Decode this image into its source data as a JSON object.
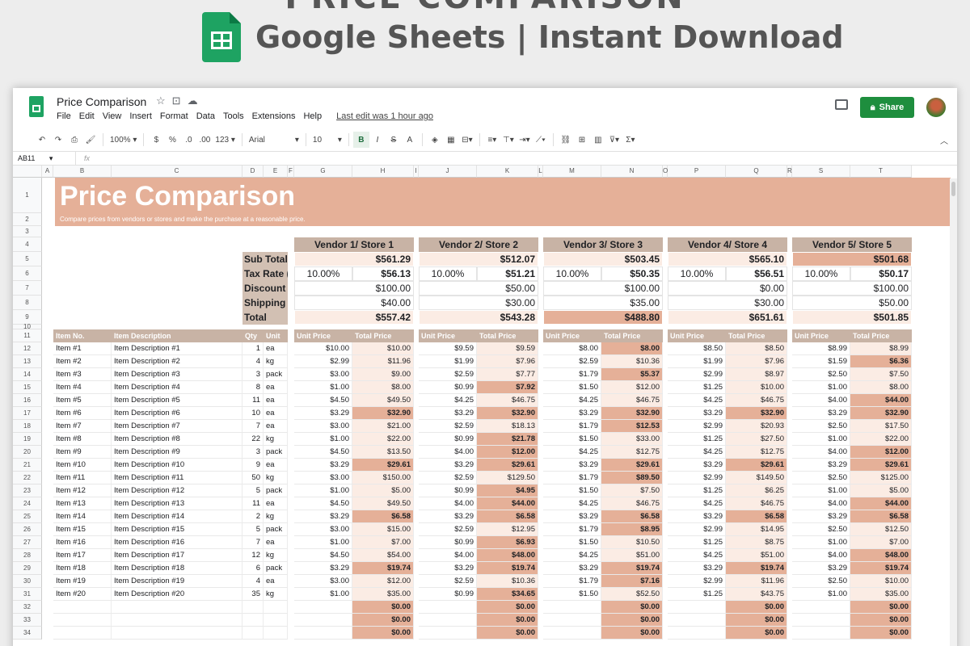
{
  "banner": {
    "cut_text": "PRICE COMPARISON",
    "subtitle": "Google Sheets | Instant Download"
  },
  "app": {
    "title": "Price Comparison",
    "menu": [
      "File",
      "Edit",
      "View",
      "Insert",
      "Format",
      "Data",
      "Tools",
      "Extensions",
      "Help"
    ],
    "last_edit": "Last edit was 1 hour ago",
    "share_label": "Share"
  },
  "toolbar": {
    "zoom": "100%",
    "currency": "$",
    "percent": "%",
    "dec_less": ".0",
    "dec_more": ".00",
    "number_format": "123",
    "font": "Arial",
    "font_size": "10",
    "bold": "B",
    "italic": "I",
    "strike": "S",
    "text_color": "A"
  },
  "formula": {
    "name_box": "AB11",
    "fx": "fx"
  },
  "columns": [
    "A",
    "B",
    "C",
    "D",
    "E",
    "F",
    "G",
    "H",
    "I",
    "J",
    "K",
    "L",
    "M",
    "N",
    "O",
    "P",
    "Q",
    "R",
    "S",
    "T"
  ],
  "rows": [
    "1",
    "2",
    "3",
    "4",
    "5",
    "6",
    "7",
    "8",
    "9",
    "10",
    "11",
    "12",
    "13",
    "14",
    "15",
    "16",
    "17",
    "18",
    "19",
    "20",
    "21",
    "22",
    "23",
    "24",
    "25",
    "26",
    "27",
    "28",
    "29",
    "30",
    "31",
    "32",
    "33",
    "34"
  ],
  "sheet": {
    "title": "Price Comparison",
    "subtitle": "Compare prices from vendors or stores and make the purchase at a reasonable price.",
    "summary_labels": [
      "Sub Total",
      "Tax Rate (%)",
      "Discount",
      "Shipping",
      "Total"
    ],
    "vendors": [
      {
        "name": "Vendor 1/ Store 1",
        "subtotal": "$561.29",
        "rate": "10.00%",
        "tax": "$56.13",
        "discount": "$100.00",
        "shipping": "$40.00",
        "total": "$557.42"
      },
      {
        "name": "Vendor 2/ Store 2",
        "subtotal": "$512.07",
        "rate": "10.00%",
        "tax": "$51.21",
        "discount": "$50.00",
        "shipping": "$30.00",
        "total": "$543.28"
      },
      {
        "name": "Vendor 3/ Store 3",
        "subtotal": "$503.45",
        "rate": "10.00%",
        "tax": "$50.35",
        "discount": "$100.00",
        "shipping": "$35.00",
        "total": "$488.80"
      },
      {
        "name": "Vendor 4/ Store 4",
        "subtotal": "$565.10",
        "rate": "10.00%",
        "tax": "$56.51",
        "discount": "$0.00",
        "shipping": "$30.00",
        "total": "$651.61"
      },
      {
        "name": "Vendor 5/ Store 5",
        "subtotal": "$501.68",
        "rate": "10.00%",
        "tax": "$50.17",
        "discount": "$100.00",
        "shipping": "$50.00",
        "total": "$501.85"
      }
    ],
    "item_headers": [
      "Item No.",
      "Item Description",
      "Qty",
      "Unit"
    ],
    "price_headers": [
      "Unit Price",
      "Total Price"
    ],
    "items": [
      [
        "Item #1",
        "Item Description #1",
        "1",
        "ea"
      ],
      [
        "Item #2",
        "Item Description #2",
        "4",
        "kg"
      ],
      [
        "Item #3",
        "Item Description #3",
        "3",
        "pack"
      ],
      [
        "Item #4",
        "Item Description #4",
        "8",
        "ea"
      ],
      [
        "Item #5",
        "Item Description #5",
        "11",
        "ea"
      ],
      [
        "Item #6",
        "Item Description #6",
        "10",
        "ea"
      ],
      [
        "Item #7",
        "Item Description #7",
        "7",
        "ea"
      ],
      [
        "Item #8",
        "Item Description #8",
        "22",
        "kg"
      ],
      [
        "Item #9",
        "Item Description #9",
        "3",
        "pack"
      ],
      [
        "Item #10",
        "Item Description #10",
        "9",
        "ea"
      ],
      [
        "Item #11",
        "Item Description #11",
        "50",
        "kg"
      ],
      [
        "Item #12",
        "Item Description #12",
        "5",
        "pack"
      ],
      [
        "Item #13",
        "Item Description #13",
        "11",
        "ea"
      ],
      [
        "Item #14",
        "Item Description #14",
        "2",
        "kg"
      ],
      [
        "Item #15",
        "Item Description #15",
        "5",
        "pack"
      ],
      [
        "Item #16",
        "Item Description #16",
        "7",
        "ea"
      ],
      [
        "Item #17",
        "Item Description #17",
        "12",
        "kg"
      ],
      [
        "Item #18",
        "Item Description #18",
        "6",
        "pack"
      ],
      [
        "Item #19",
        "Item Description #19",
        "4",
        "ea"
      ],
      [
        "Item #20",
        "Item Description #20",
        "35",
        "kg"
      ]
    ],
    "prices": [
      [
        [
          "$10.00",
          "$10.00"
        ],
        [
          "$9.59",
          "$9.59"
        ],
        [
          "$8.00",
          "$8.00"
        ],
        [
          "$8.50",
          "$8.50"
        ],
        [
          "$8.99",
          "$8.99"
        ]
      ],
      [
        [
          "$2.99",
          "$11.96"
        ],
        [
          "$1.99",
          "$7.96"
        ],
        [
          "$2.59",
          "$10.36"
        ],
        [
          "$1.99",
          "$7.96"
        ],
        [
          "$1.59",
          "$6.36"
        ]
      ],
      [
        [
          "$3.00",
          "$9.00"
        ],
        [
          "$2.59",
          "$7.77"
        ],
        [
          "$1.79",
          "$5.37"
        ],
        [
          "$2.99",
          "$8.97"
        ],
        [
          "$2.50",
          "$7.50"
        ]
      ],
      [
        [
          "$1.00",
          "$8.00"
        ],
        [
          "$0.99",
          "$7.92"
        ],
        [
          "$1.50",
          "$12.00"
        ],
        [
          "$1.25",
          "$10.00"
        ],
        [
          "$1.00",
          "$8.00"
        ]
      ],
      [
        [
          "$4.50",
          "$49.50"
        ],
        [
          "$4.25",
          "$46.75"
        ],
        [
          "$4.25",
          "$46.75"
        ],
        [
          "$4.25",
          "$46.75"
        ],
        [
          "$4.00",
          "$44.00"
        ]
      ],
      [
        [
          "$3.29",
          "$32.90"
        ],
        [
          "$3.29",
          "$32.90"
        ],
        [
          "$3.29",
          "$32.90"
        ],
        [
          "$3.29",
          "$32.90"
        ],
        [
          "$3.29",
          "$32.90"
        ]
      ],
      [
        [
          "$3.00",
          "$21.00"
        ],
        [
          "$2.59",
          "$18.13"
        ],
        [
          "$1.79",
          "$12.53"
        ],
        [
          "$2.99",
          "$20.93"
        ],
        [
          "$2.50",
          "$17.50"
        ]
      ],
      [
        [
          "$1.00",
          "$22.00"
        ],
        [
          "$0.99",
          "$21.78"
        ],
        [
          "$1.50",
          "$33.00"
        ],
        [
          "$1.25",
          "$27.50"
        ],
        [
          "$1.00",
          "$22.00"
        ]
      ],
      [
        [
          "$4.50",
          "$13.50"
        ],
        [
          "$4.00",
          "$12.00"
        ],
        [
          "$4.25",
          "$12.75"
        ],
        [
          "$4.25",
          "$12.75"
        ],
        [
          "$4.00",
          "$12.00"
        ]
      ],
      [
        [
          "$3.29",
          "$29.61"
        ],
        [
          "$3.29",
          "$29.61"
        ],
        [
          "$3.29",
          "$29.61"
        ],
        [
          "$3.29",
          "$29.61"
        ],
        [
          "$3.29",
          "$29.61"
        ]
      ],
      [
        [
          "$3.00",
          "$150.00"
        ],
        [
          "$2.59",
          "$129.50"
        ],
        [
          "$1.79",
          "$89.50"
        ],
        [
          "$2.99",
          "$149.50"
        ],
        [
          "$2.50",
          "$125.00"
        ]
      ],
      [
        [
          "$1.00",
          "$5.00"
        ],
        [
          "$0.99",
          "$4.95"
        ],
        [
          "$1.50",
          "$7.50"
        ],
        [
          "$1.25",
          "$6.25"
        ],
        [
          "$1.00",
          "$5.00"
        ]
      ],
      [
        [
          "$4.50",
          "$49.50"
        ],
        [
          "$4.00",
          "$44.00"
        ],
        [
          "$4.25",
          "$46.75"
        ],
        [
          "$4.25",
          "$46.75"
        ],
        [
          "$4.00",
          "$44.00"
        ]
      ],
      [
        [
          "$3.29",
          "$6.58"
        ],
        [
          "$3.29",
          "$6.58"
        ],
        [
          "$3.29",
          "$6.58"
        ],
        [
          "$3.29",
          "$6.58"
        ],
        [
          "$3.29",
          "$6.58"
        ]
      ],
      [
        [
          "$3.00",
          "$15.00"
        ],
        [
          "$2.59",
          "$12.95"
        ],
        [
          "$1.79",
          "$8.95"
        ],
        [
          "$2.99",
          "$14.95"
        ],
        [
          "$2.50",
          "$12.50"
        ]
      ],
      [
        [
          "$1.00",
          "$7.00"
        ],
        [
          "$0.99",
          "$6.93"
        ],
        [
          "$1.50",
          "$10.50"
        ],
        [
          "$1.25",
          "$8.75"
        ],
        [
          "$1.00",
          "$7.00"
        ]
      ],
      [
        [
          "$4.50",
          "$54.00"
        ],
        [
          "$4.00",
          "$48.00"
        ],
        [
          "$4.25",
          "$51.00"
        ],
        [
          "$4.25",
          "$51.00"
        ],
        [
          "$4.00",
          "$48.00"
        ]
      ],
      [
        [
          "$3.29",
          "$19.74"
        ],
        [
          "$3.29",
          "$19.74"
        ],
        [
          "$3.29",
          "$19.74"
        ],
        [
          "$3.29",
          "$19.74"
        ],
        [
          "$3.29",
          "$19.74"
        ]
      ],
      [
        [
          "$3.00",
          "$12.00"
        ],
        [
          "$2.59",
          "$10.36"
        ],
        [
          "$1.79",
          "$7.16"
        ],
        [
          "$2.99",
          "$11.96"
        ],
        [
          "$2.50",
          "$10.00"
        ]
      ],
      [
        [
          "$1.00",
          "$35.00"
        ],
        [
          "$0.99",
          "$34.65"
        ],
        [
          "$1.50",
          "$52.50"
        ],
        [
          "$1.25",
          "$43.75"
        ],
        [
          "$1.00",
          "$35.00"
        ]
      ]
    ],
    "min_flags": [
      [
        0,
        0,
        1,
        0,
        0
      ],
      [
        0,
        0,
        0,
        0,
        1
      ],
      [
        0,
        0,
        1,
        0,
        0
      ],
      [
        0,
        1,
        0,
        0,
        0
      ],
      [
        0,
        0,
        0,
        0,
        1
      ],
      [
        1,
        1,
        1,
        1,
        1
      ],
      [
        0,
        0,
        1,
        0,
        0
      ],
      [
        0,
        1,
        0,
        0,
        0
      ],
      [
        0,
        1,
        0,
        0,
        1
      ],
      [
        1,
        1,
        1,
        1,
        1
      ],
      [
        0,
        0,
        1,
        0,
        0
      ],
      [
        0,
        1,
        0,
        0,
        0
      ],
      [
        0,
        1,
        0,
        0,
        1
      ],
      [
        1,
        1,
        1,
        1,
        1
      ],
      [
        0,
        0,
        1,
        0,
        0
      ],
      [
        0,
        1,
        0,
        0,
        0
      ],
      [
        0,
        1,
        0,
        0,
        1
      ],
      [
        1,
        1,
        1,
        1,
        1
      ],
      [
        0,
        0,
        1,
        0,
        0
      ],
      [
        0,
        1,
        0,
        0,
        0
      ]
    ],
    "zero_total": "$0.00",
    "colors": {
      "accent": "#e5b098",
      "header_tan": "#c8b3a5",
      "label_tan": "#d2c0b3",
      "light": "#fbece4",
      "share_green": "#1e8e3e"
    }
  }
}
